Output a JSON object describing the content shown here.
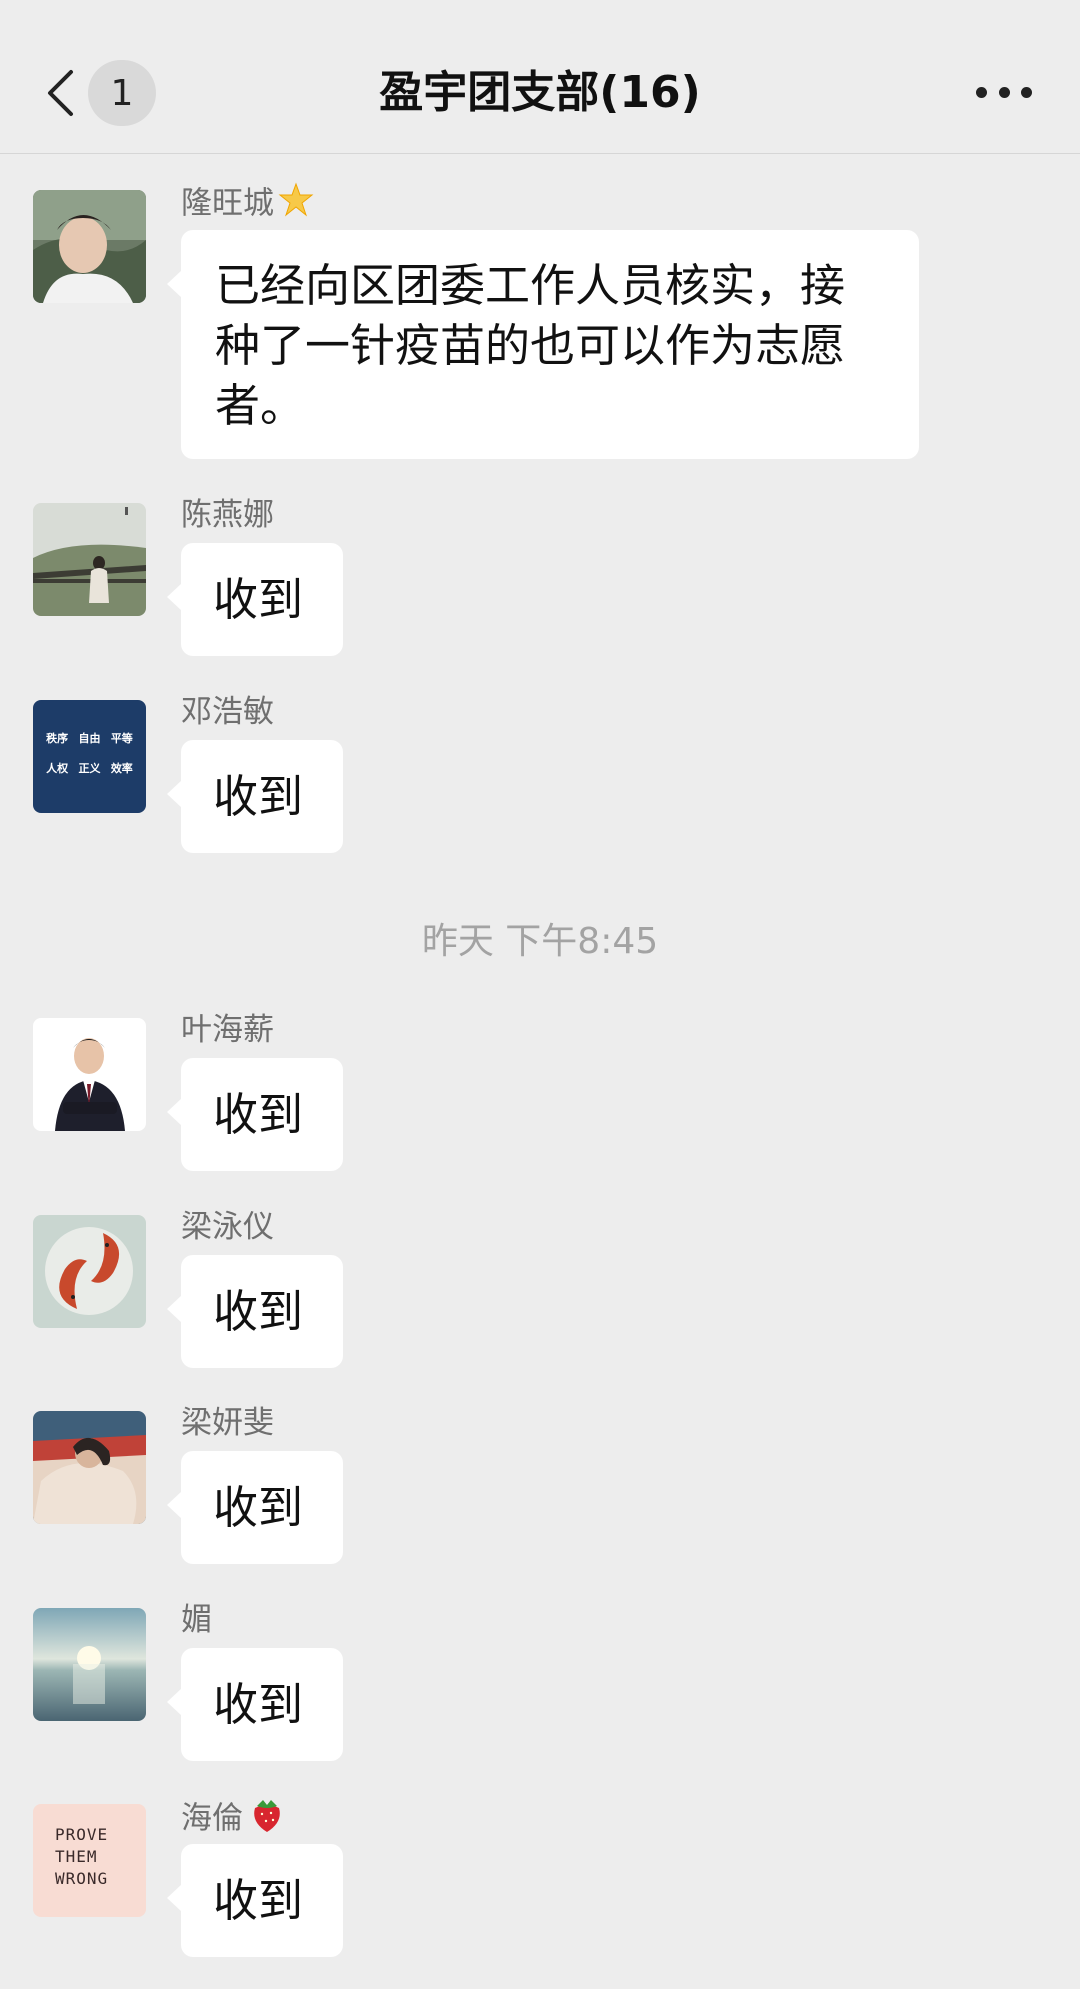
{
  "header": {
    "back_icon": "chevron-left-icon",
    "unread_count": "1",
    "title": "盈宇团支部(16)",
    "more_icon": "more-icon"
  },
  "timestamp": "昨天 下午8:45",
  "messages": [
    {
      "sender": "隆旺城",
      "badge": "star-emoji",
      "text": "已经向区团委工作人员核实，接种了一针疫苗的也可以作为志愿者。"
    },
    {
      "sender": "陈燕娜",
      "text": "收到"
    },
    {
      "sender": "邓浩敏",
      "text": "收到",
      "avatar_text": [
        "秩序",
        "自由",
        "平等",
        "人权",
        "正义",
        "效率"
      ]
    },
    {
      "sender": "叶海薪",
      "text": "收到"
    },
    {
      "sender": "梁泳仪",
      "text": "收到"
    },
    {
      "sender": "梁妍斐",
      "text": "收到"
    },
    {
      "sender": "媚",
      "text": "收到"
    },
    {
      "sender": "海倫",
      "badge": "strawberry-emoji",
      "text": "收到",
      "avatar_text": "PROVE THEM WRONG"
    }
  ],
  "colors": {
    "background": "#ededed",
    "bubble": "#ffffff",
    "sender_text": "#6f6f6f",
    "timestamp_text": "#a3a3a3"
  }
}
